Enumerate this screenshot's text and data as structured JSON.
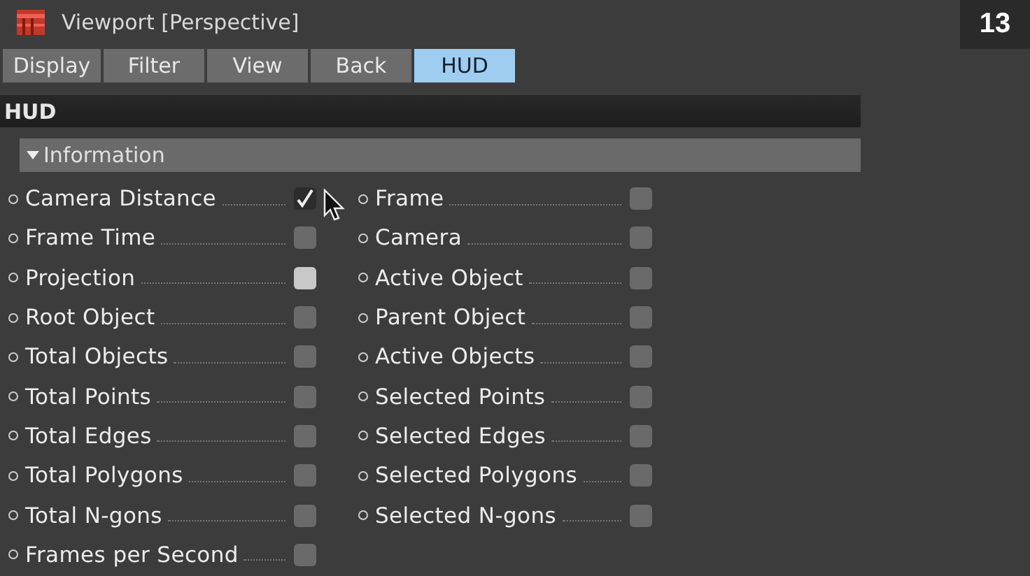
{
  "window": {
    "title": "Viewport [Perspective]"
  },
  "page_number": "13",
  "tabs": [
    {
      "label": "Display",
      "selected": false
    },
    {
      "label": "Filter",
      "selected": false
    },
    {
      "label": "View",
      "selected": false
    },
    {
      "label": "Back",
      "selected": false
    },
    {
      "label": "HUD",
      "selected": true
    }
  ],
  "section": {
    "title": "HUD"
  },
  "group": {
    "title": "Information",
    "expanded": true,
    "columns": [
      [
        {
          "label": "Camera Distance",
          "checked": true,
          "highlighted": false
        },
        {
          "label": "Frame Time",
          "checked": false,
          "highlighted": false
        },
        {
          "label": "Projection",
          "checked": false,
          "highlighted": true
        },
        {
          "label": "Root Object",
          "checked": false,
          "highlighted": false
        },
        {
          "label": "Total Objects",
          "checked": false,
          "highlighted": false
        },
        {
          "label": "Total Points",
          "checked": false,
          "highlighted": false
        },
        {
          "label": "Total Edges",
          "checked": false,
          "highlighted": false
        },
        {
          "label": "Total Polygons",
          "checked": false,
          "highlighted": false
        },
        {
          "label": "Total N-gons",
          "checked": false,
          "highlighted": false
        },
        {
          "label": "Frames per Second",
          "checked": false,
          "highlighted": false
        }
      ],
      [
        {
          "label": "Frame",
          "checked": false,
          "highlighted": false
        },
        {
          "label": "Camera",
          "checked": false,
          "highlighted": false
        },
        {
          "label": "Active Object",
          "checked": false,
          "highlighted": false
        },
        {
          "label": "Parent Object",
          "checked": false,
          "highlighted": false
        },
        {
          "label": "Active Objects",
          "checked": false,
          "highlighted": false
        },
        {
          "label": "Selected Points",
          "checked": false,
          "highlighted": false
        },
        {
          "label": "Selected Edges",
          "checked": false,
          "highlighted": false
        },
        {
          "label": "Selected Polygons",
          "checked": false,
          "highlighted": false
        },
        {
          "label": "Selected N-gons",
          "checked": false,
          "highlighted": false
        }
      ]
    ]
  }
}
